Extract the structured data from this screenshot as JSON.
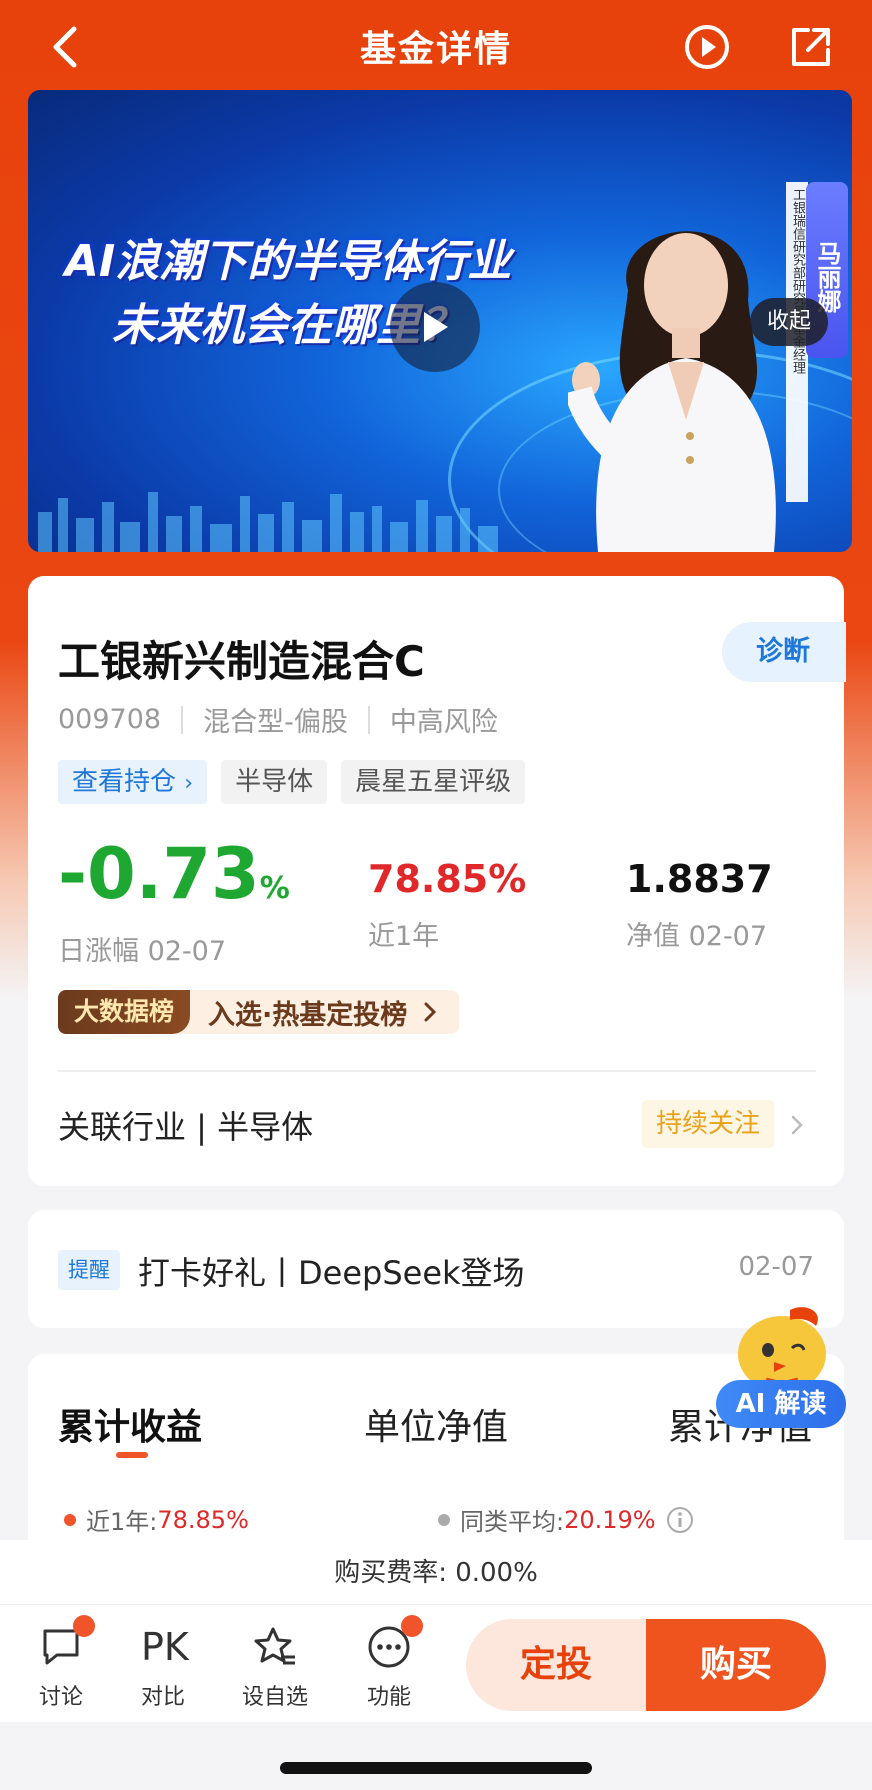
{
  "header": {
    "title": "基金详情",
    "icons": [
      "back-icon",
      "play-circle-icon",
      "share-icon"
    ]
  },
  "banner": {
    "headline_line1": "AI浪潮下的半导体行业",
    "headline_line2": "未来机会在哪里？",
    "name": "马丽娜",
    "role": "工银瑞信研究部研究员 基金经理",
    "collapse_label": "收起"
  },
  "fund": {
    "name": "工银新兴制造混合C",
    "diagnose_label": "诊断",
    "code": "009708",
    "type": "混合型-偏股",
    "risk": "中高风险",
    "tags": [
      "查看持仓",
      "半导体",
      "晨星五星评级"
    ],
    "daily_change": "-0.73",
    "daily_change_unit": "%",
    "daily_change_label": "日涨幅 02-07",
    "year_return": "78.85%",
    "year_return_label": "近1年",
    "nav": "1.8837",
    "nav_label": "净值 02-07",
    "rank_badge": "大数据榜",
    "rank_text": "入选·热基定投榜",
    "industry": "关联行业 | 半导体",
    "follow_label": "持续关注"
  },
  "reminder": {
    "badge": "提醒",
    "text": "打卡好礼丨DeepSeek登场",
    "date": "02-07"
  },
  "chart_tabs": {
    "tabs": [
      "累计收益",
      "单位净值",
      "累计净值"
    ],
    "legend_fund_label": "近1年:",
    "legend_fund_value": "78.85%",
    "legend_avg_label": "同类平均:",
    "legend_avg_value": "20.19%"
  },
  "ai_button": {
    "label": "AI 解读"
  },
  "fee": {
    "text": "购买费率: 0.00%"
  },
  "toolbar": {
    "discuss": "讨论",
    "pk_glyph": "PK",
    "compare": "对比",
    "watchlist": "设自选",
    "functions": "功能",
    "sip": "定投",
    "buy": "购买"
  },
  "colors": {
    "brand": "#e8420c",
    "down": "#1ea832",
    "up": "#e0282a",
    "link": "#1f78d9"
  }
}
